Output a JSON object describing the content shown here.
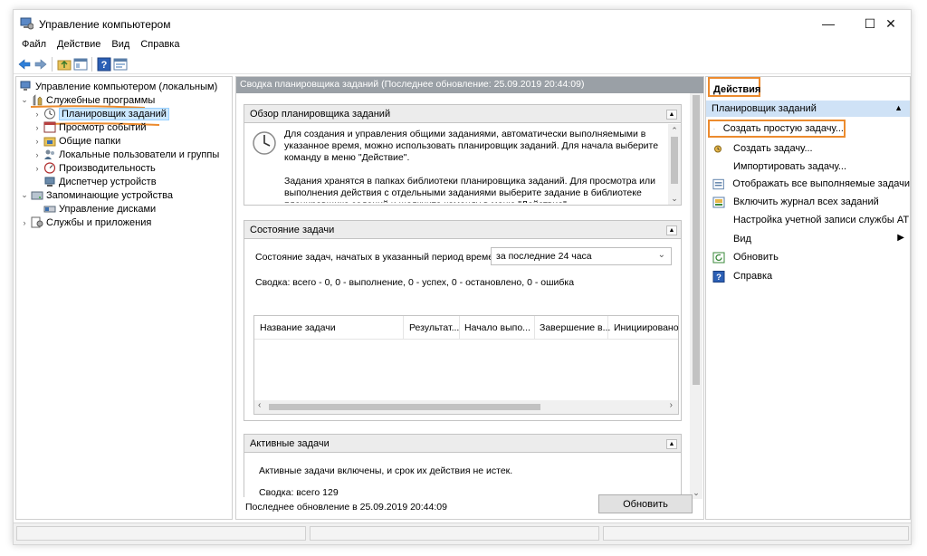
{
  "window": {
    "title": "Управление компьютером",
    "minimize_glyph": "—",
    "maximize_glyph": "☐",
    "close_glyph": "✕"
  },
  "menu": [
    "Файл",
    "Действие",
    "Вид",
    "Справка"
  ],
  "toolbar_icons": [
    "back-arrow-icon",
    "forward-arrow-icon",
    "up-folder-icon",
    "show-hide-tree-icon",
    "help-icon",
    "properties-icon"
  ],
  "tree": {
    "root": "Управление компьютером (локальным)",
    "items": [
      {
        "label": "Служебные программы",
        "icon": "tools-icon",
        "arrow": "⌄"
      },
      {
        "label": "Планировщик заданий",
        "icon": "clock-icon",
        "arrow": "›"
      },
      {
        "label": "Просмотр событий",
        "icon": "event-viewer-icon",
        "arrow": "›"
      },
      {
        "label": "Общие папки",
        "icon": "shared-folder-icon",
        "arrow": "›"
      },
      {
        "label": "Локальные пользователи и группы",
        "icon": "users-icon",
        "arrow": "›"
      },
      {
        "label": "Производительность",
        "icon": "performance-icon",
        "arrow": "›"
      },
      {
        "label": "Диспетчер устройств",
        "icon": "device-manager-icon",
        "arrow": ""
      },
      {
        "label": "Запоминающие устройства",
        "icon": "storage-icon",
        "arrow": "⌄"
      },
      {
        "label": "Управление дисками",
        "icon": "disk-icon",
        "arrow": ""
      },
      {
        "label": "Службы и приложения",
        "icon": "services-icon",
        "arrow": "›"
      }
    ]
  },
  "center": {
    "header": "Сводка планировщика заданий (Последнее обновление: 25.09.2019 20:44:09)",
    "overview": {
      "title": "Обзор планировщика заданий",
      "para1": "Для создания и управления общими заданиями, автоматически выполняемыми в указанное время, можно использовать планировщик заданий. Для начала выберите команду в меню \"Действие\".",
      "para2": "Задания хранятся в папках библиотеки планировщика заданий. Для просмотра или выполнения действия с отдельными заданиями выберите задание в библиотеке планировщика заданий и щелкните команду в меню \"Действие\"."
    },
    "status": {
      "title": "Состояние задачи",
      "period_label": "Состояние задач, начатых в указанный период време...",
      "period_value": "за последние 24 часа",
      "summary": "Сводка: всего - 0, 0 - выполнение, 0 - успех, 0 - остановлено, 0 - ошибка",
      "columns": [
        "Название задачи",
        "Результат...",
        "Начало выпо...",
        "Завершение в...",
        "Инициировано"
      ]
    },
    "active": {
      "title": "Активные задачи",
      "text": "Активные задачи включены, и срок их действия не истек.",
      "summary": "Сводка: всего 129"
    },
    "footer_updated": "Последнее обновление в 25.09.2019 20:44:09",
    "refresh_button": "Обновить"
  },
  "actions": {
    "title": "Действия",
    "group": "Планировщик заданий",
    "items": [
      {
        "label": "Создать простую задачу...",
        "icon": "create-basic-task-icon"
      },
      {
        "label": "Создать задачу...",
        "icon": "create-task-icon"
      },
      {
        "label": "Импортировать задачу...",
        "icon": ""
      },
      {
        "label": "Отображать все выполняемые задачи",
        "icon": "running-tasks-icon"
      },
      {
        "label": "Включить журнал всех заданий",
        "icon": "history-icon"
      },
      {
        "label": "Настройка учетной записи службы AT",
        "icon": ""
      },
      {
        "label": "Вид",
        "icon": "",
        "submenu": true
      },
      {
        "label": "Обновить",
        "icon": "refresh-icon"
      },
      {
        "label": "Справка",
        "icon": "help-icon"
      }
    ]
  },
  "colors": {
    "highlight_orange": "#ec8b2e",
    "header_gray": "#9aa0a6",
    "actions_group_blue": "#cfe2f6",
    "selected_bg": "#cce8ff"
  }
}
